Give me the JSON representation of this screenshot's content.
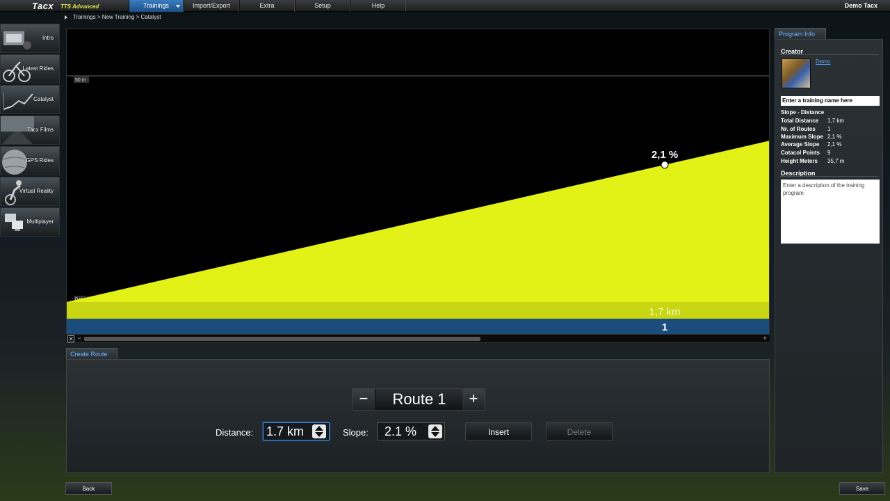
{
  "app": {
    "logo": "Tacx",
    "edition": "TTS Advanced",
    "user": "Demo Tacx"
  },
  "menu": [
    "Trainings",
    "Import/Export",
    "Extra",
    "Setup",
    "Help"
  ],
  "breadcrumb": "Trainings > New Training > Catalyst",
  "sidebar": [
    {
      "label": "Intro",
      "icon": "trainer-icon"
    },
    {
      "label": "Latest Rides",
      "icon": "cyclist-icon"
    },
    {
      "label": "Catalyst",
      "icon": "catalyst-graph-icon"
    },
    {
      "label": "Tacx Films",
      "icon": "film-road-icon"
    },
    {
      "label": "GPS Rides",
      "icon": "globe-icon"
    },
    {
      "label": "Virtual Reality",
      "icon": "vr-cyclist-icon"
    },
    {
      "label": "Multiplayer",
      "icon": "network-computers-icon"
    }
  ],
  "chart_data": {
    "type": "area",
    "ytick_top": "50 m",
    "ytick_bottom": "0 m",
    "ylim": [
      0,
      50
    ],
    "profile": [
      {
        "x": 0,
        "y": 0
      },
      {
        "x": 1.7,
        "y": 35.7
      }
    ],
    "point_label": "2,1 %",
    "distance_label": "1,7 km",
    "route_label": "1",
    "colors": {
      "profile": "#e2f217",
      "route_band": "#1c4c7c",
      "background": "#000000"
    }
  },
  "create_route": {
    "tab": "Create Route",
    "route_name": "Route 1",
    "distance_label": "Distance:",
    "distance_value": "1.7 km",
    "slope_label": "Slope:",
    "slope_value": "2.1 %",
    "insert": "Insert",
    "delete": "Delete"
  },
  "program_info": {
    "tab": "Program Info",
    "creator_title": "Creator",
    "creator_name": "Demo",
    "name_placeholder": "Enter a training name here",
    "type": "Slope - Distance",
    "stats": [
      {
        "key": "Total Distance",
        "value": "1,7 km"
      },
      {
        "key": "Nr. of Routes",
        "value": "1"
      },
      {
        "key": "Maximum Slope",
        "value": "2,1 %"
      },
      {
        "key": "Average Slope",
        "value": "2,1 %"
      },
      {
        "key": "Cotacol Points",
        "value": "9"
      },
      {
        "key": "Height Meters",
        "value": "35,7 m"
      }
    ],
    "description_title": "Description",
    "description_placeholder": "Enter a description of the training program"
  },
  "buttons": {
    "back": "Back",
    "save": "Save"
  }
}
